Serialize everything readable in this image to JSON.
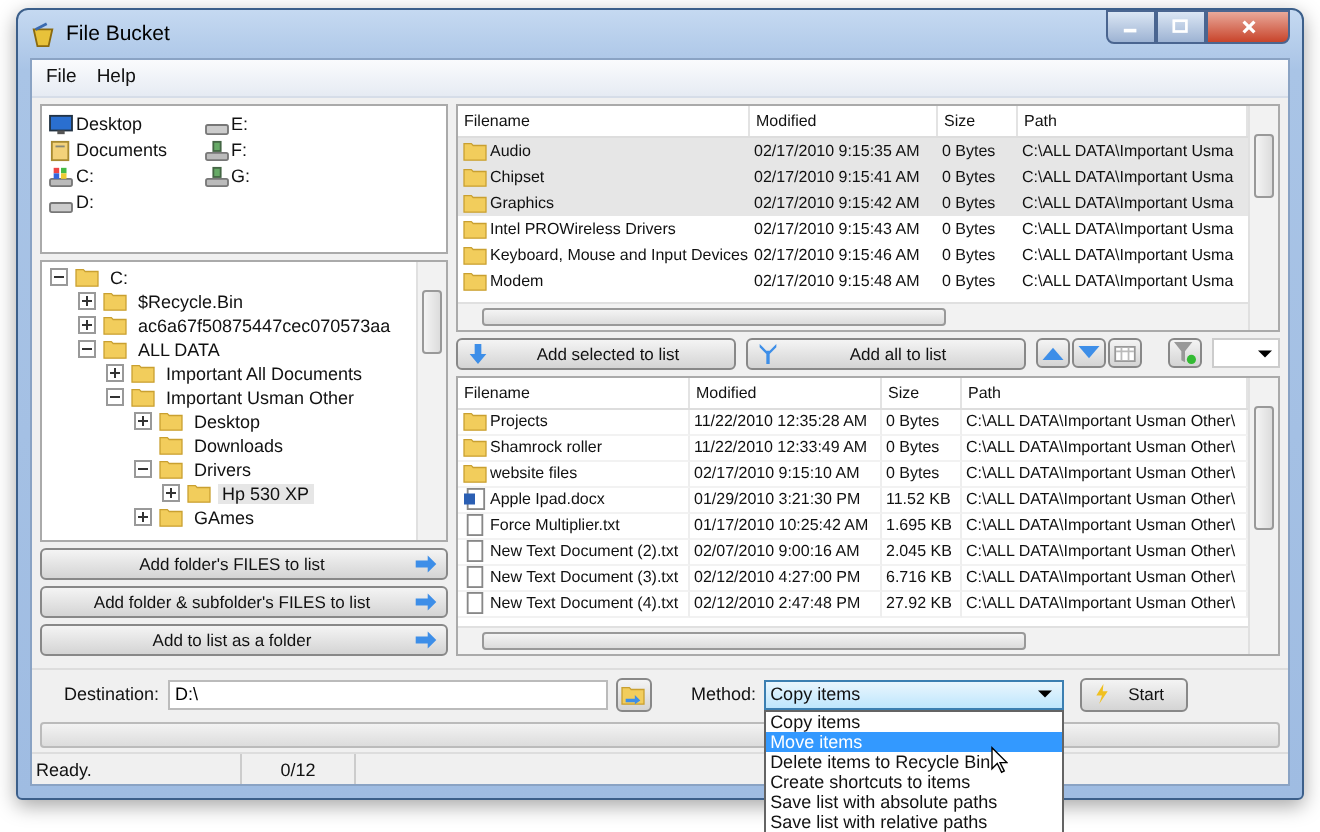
{
  "window": {
    "title": "File Bucket"
  },
  "menu": [
    "File",
    "Help"
  ],
  "drives": [
    {
      "name": "Desktop",
      "kind": "desktop"
    },
    {
      "name": "Documents",
      "kind": "documents"
    },
    {
      "name": "C:",
      "kind": "system"
    },
    {
      "name": "D:",
      "kind": "drive"
    },
    {
      "name": "E:",
      "kind": "drive"
    },
    {
      "name": "F:",
      "kind": "network"
    },
    {
      "name": "G:",
      "kind": "network"
    }
  ],
  "tree": [
    {
      "label": "C:",
      "expanded": true,
      "selected": false,
      "children": [
        {
          "label": "$Recycle.Bin",
          "expanded": false,
          "selected": false
        },
        {
          "label": "ac6a67f50875447cec070573aa",
          "expanded": false,
          "selected": false
        },
        {
          "label": "ALL DATA",
          "expanded": true,
          "selected": false,
          "children": [
            {
              "label": "Important All Documents",
              "expanded": false,
              "selected": false
            },
            {
              "label": "Important Usman Other",
              "expanded": true,
              "selected": false,
              "children": [
                {
                  "label": "Desktop",
                  "expanded": false,
                  "selected": false
                },
                {
                  "label": "Downloads",
                  "selected": false
                },
                {
                  "label": "Drivers",
                  "expanded": true,
                  "selected": false,
                  "children": [
                    {
                      "label": "Hp 530 XP",
                      "expanded": false,
                      "selected": true
                    }
                  ]
                },
                {
                  "label": "GAmes",
                  "expanded": false,
                  "selected": false
                }
              ]
            }
          ]
        }
      ]
    }
  ],
  "left_buttons": [
    "Add folder's FILES to list",
    "Add folder & subfolder's FILES to list",
    "Add to list as a folder"
  ],
  "browser_table": {
    "columns": [
      "Filename",
      "Modified",
      "Size",
      "Path"
    ],
    "rows": [
      {
        "kind": "folder",
        "selected": true,
        "cells": [
          "Audio",
          "02/17/2010 9:15:35 AM",
          "0 Bytes",
          "C:\\ALL DATA\\Important Usma"
        ]
      },
      {
        "kind": "folder",
        "selected": true,
        "cells": [
          "Chipset",
          "02/17/2010 9:15:41 AM",
          "0 Bytes",
          "C:\\ALL DATA\\Important Usma"
        ]
      },
      {
        "kind": "folder",
        "selected": true,
        "cells": [
          "Graphics",
          "02/17/2010 9:15:42 AM",
          "0 Bytes",
          "C:\\ALL DATA\\Important Usma"
        ]
      },
      {
        "kind": "folder",
        "selected": false,
        "cells": [
          "Intel PROWireless Drivers",
          "02/17/2010 9:15:43 AM",
          "0 Bytes",
          "C:\\ALL DATA\\Important Usma"
        ]
      },
      {
        "kind": "folder",
        "selected": false,
        "cells": [
          "Keyboard, Mouse and Input Devices",
          "02/17/2010 9:15:46 AM",
          "0 Bytes",
          "C:\\ALL DATA\\Important Usma"
        ]
      },
      {
        "kind": "folder",
        "selected": false,
        "cells": [
          "Modem",
          "02/17/2010 9:15:48 AM",
          "0 Bytes",
          "C:\\ALL DATA\\Important Usma"
        ]
      }
    ]
  },
  "add_selected_button": "Add selected to list",
  "add_all_button": "Add all to list",
  "list_table": {
    "columns": [
      "Filename",
      "Modified",
      "Size",
      "Path"
    ],
    "rows": [
      {
        "kind": "folder",
        "cells": [
          "Projects",
          "11/22/2010 12:35:28 AM",
          "0 Bytes",
          "C:\\ALL DATA\\Important Usman Other\\"
        ]
      },
      {
        "kind": "folder",
        "cells": [
          "Shamrock roller",
          "11/22/2010 12:33:49 AM",
          "0 Bytes",
          "C:\\ALL DATA\\Important Usman Other\\"
        ]
      },
      {
        "kind": "folder",
        "cells": [
          "website files",
          "02/17/2010 9:15:10 AM",
          "0 Bytes",
          "C:\\ALL DATA\\Important Usman Other\\"
        ]
      },
      {
        "kind": "word",
        "cells": [
          "Apple Ipad.docx",
          "01/29/2010 3:21:30 PM",
          "11.52 KB",
          "C:\\ALL DATA\\Important Usman Other\\"
        ]
      },
      {
        "kind": "text",
        "cells": [
          "Force Multiplier.txt",
          "01/17/2010 10:25:42 AM",
          "1.695 KB",
          "C:\\ALL DATA\\Important Usman Other\\"
        ]
      },
      {
        "kind": "text",
        "cells": [
          "New Text Document (2).txt",
          "02/07/2010 9:00:16 AM",
          "2.045 KB",
          "C:\\ALL DATA\\Important Usman Other\\"
        ]
      },
      {
        "kind": "text",
        "cells": [
          "New Text Document (3).txt",
          "02/12/2010 4:27:00 PM",
          "6.716 KB",
          "C:\\ALL DATA\\Important Usman Other\\"
        ]
      },
      {
        "kind": "text",
        "cells": [
          "New Text Document (4).txt",
          "02/12/2010 2:47:48 PM",
          "27.92 KB",
          "C:\\ALL DATA\\Important Usman Other\\"
        ]
      }
    ]
  },
  "destination": {
    "label": "Destination:",
    "value": "D:\\"
  },
  "method": {
    "label": "Method:",
    "value": "Copy items",
    "options": [
      {
        "label": "Copy items",
        "highlighted": false
      },
      {
        "label": "Move items",
        "highlighted": true
      },
      {
        "label": "Delete items to Recycle Bin",
        "highlighted": false
      },
      {
        "label": "Create shortcuts to items",
        "highlighted": false
      },
      {
        "label": "Save list with absolute paths",
        "highlighted": false
      },
      {
        "label": "Save list with relative paths",
        "highlighted": false
      }
    ]
  },
  "start_button": "Start",
  "progress": {
    "level": 0
  },
  "status_bar": {
    "message": "Ready.",
    "count": "0/12"
  }
}
